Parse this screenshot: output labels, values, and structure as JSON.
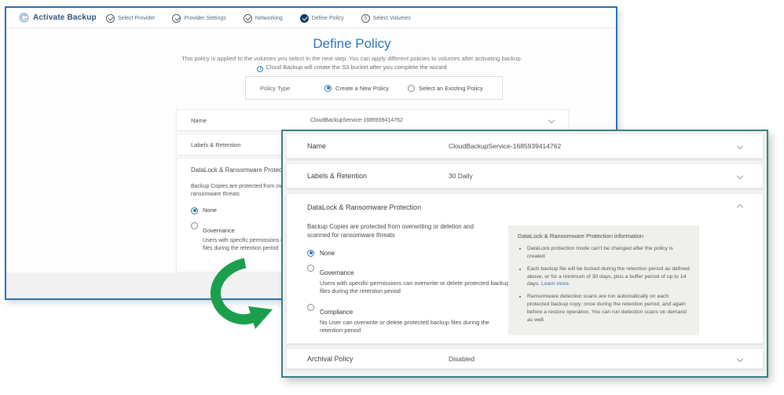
{
  "app": {
    "title": "Activate Backup"
  },
  "steps": [
    {
      "label": "Select Provider",
      "state": "done"
    },
    {
      "label": "Provider Settings",
      "state": "done"
    },
    {
      "label": "Networking",
      "state": "done"
    },
    {
      "label": "Define Policy",
      "state": "current"
    },
    {
      "label": "Select Volumes",
      "state": "upcoming",
      "number": "5"
    }
  ],
  "page": {
    "title": "Define Policy",
    "subtitle": "This policy is applied to the volumes you select in the next step. You can apply different policies to volumes after activating backup.",
    "info_note": "Cloud Backup will create the S3 bucket after you complete the wizard",
    "policy_type": {
      "label": "Policy Type",
      "option_new": "Create a New Policy",
      "option_existing": "Select an Existing Policy"
    }
  },
  "rows": {
    "name": {
      "label": "Name",
      "value": "CloudBackupService-1685939414762"
    },
    "labels_retention": {
      "label": "Labels & Retention",
      "value": "30 Daily"
    },
    "archival": {
      "label": "Archival Policy",
      "value": "Disabled"
    }
  },
  "datalock": {
    "title": "DataLock & Ransomware Protection",
    "description": "Backup Copies are protected from overwriting or deletion and scanned for ransomware threats",
    "options": [
      {
        "label": "None",
        "description": ""
      },
      {
        "label": "Governance",
        "description": "Users with specific permissions can overwrite or delete protected backup files during the retention period"
      },
      {
        "label": "Compliance",
        "description": "No User can overwrite or delete protected backup files during the retention period"
      }
    ],
    "info_box": {
      "title": "DataLock & Ransomware Protection information",
      "bullets": [
        "DataLock protection mode can't be changed after the policy is created",
        "Each backup file will be locked during the retention period as defined above, or for a minimum of 30 days, plus a buffer period of up to 14 days.",
        "Ransomware detection scans are run automatically on each protected backup copy: once during the retention period, and again before a restore operation. You can run detection scans on demand as well."
      ],
      "learn_more": "Learn more."
    }
  },
  "colors": {
    "accent_blue": "#2e75b6",
    "window_border_blue": "#2a6fad",
    "panel_border_teal": "#377e81",
    "arrow_green": "#1b9e4d",
    "step_current_fill": "#123a5f",
    "link_blue": "#2e75b6"
  }
}
